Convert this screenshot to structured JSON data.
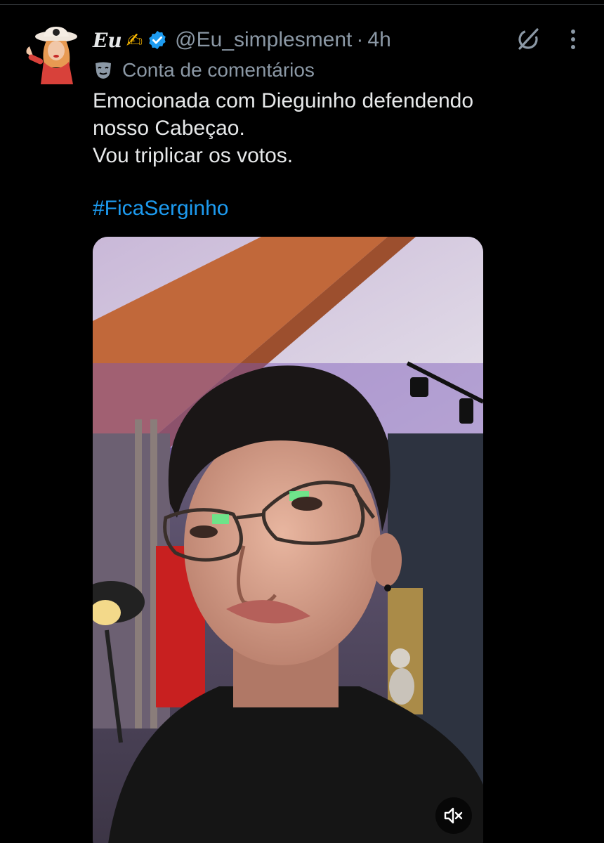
{
  "post": {
    "display_name": "Eu",
    "name_emoji": "✍",
    "handle": "@Eu_simplesment",
    "separator": "·",
    "time": "4h",
    "account_label": "Conta de comentários",
    "text_lines": [
      "Emocionada com Dieguinho defendendo",
      "nosso Cabeçao.",
      "Vou triplicar os votos."
    ],
    "hashtag": "#FicaSerginho"
  },
  "icons": {
    "verified": "verified-badge-icon",
    "grok": "grok-icon",
    "more": "more-options-icon",
    "label": "theater-mask-icon",
    "mute": "speaker-muted-icon"
  },
  "colors": {
    "background": "#000000",
    "text": "#e7e9ea",
    "secondary": "#8b98a5",
    "accent": "#1d9bf0"
  }
}
